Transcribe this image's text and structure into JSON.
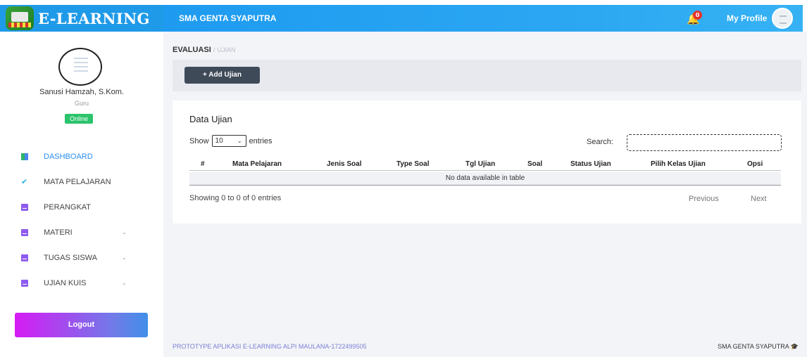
{
  "header": {
    "brand_title": "E-LEARNING",
    "school_name": "SMA GENTA SYAPUTRA",
    "notification_count": "0",
    "profile_label": "My Profile"
  },
  "sidebar": {
    "user_name": "Sanusi Hamzah, S.Kom.",
    "user_role": "Guru",
    "status": "Online",
    "items": [
      {
        "label": "DASHBOARD",
        "icon": "dashboard-icon",
        "active": true
      },
      {
        "label": "MATA PELAJARAN",
        "icon": "check-icon"
      },
      {
        "label": "PERANGKAT",
        "icon": "document-icon"
      },
      {
        "label": "MATERI",
        "icon": "document-icon",
        "dropdown": true
      },
      {
        "label": "TUGAS SISWA",
        "icon": "document-icon",
        "dropdown": true
      },
      {
        "label": "UJIAN KUIS",
        "icon": "document-icon",
        "dropdown": true
      }
    ],
    "logout_label": "Logout"
  },
  "breadcrumb": {
    "section": "EVALUASI",
    "separator": "/",
    "page": "UJIAN"
  },
  "toolbar": {
    "add_label": "+ Add Ujian"
  },
  "table_card": {
    "title": "Data Ujian",
    "show_prefix": "Show",
    "show_value": "10",
    "show_suffix": "entries",
    "search_label": "Search:",
    "search_value": "",
    "columns": [
      "#",
      "Mata Pelajaran",
      "Jenis Soal",
      "Type Soal",
      "Tgl Ujian",
      "Soal",
      "Status Ujian",
      "Pilih Kelas Ujian",
      "Opsi"
    ],
    "empty_message": "No data available in table",
    "info": "Showing 0 to 0 of 0 entries",
    "previous_label": "Previous",
    "next_label": "Next"
  },
  "footer": {
    "left": "PROTOTYPE APLIKASI E-LEARNING ALPI MAULANA-1722499505",
    "right": "SMA GENTA SYAPUTRA"
  },
  "colors": {
    "brand_blue": "#1f9ae8",
    "active_menu": "#2b8ef0",
    "online_green": "#2bc36b",
    "button_dark": "#3f4a59",
    "badge_red": "#e8312d"
  }
}
